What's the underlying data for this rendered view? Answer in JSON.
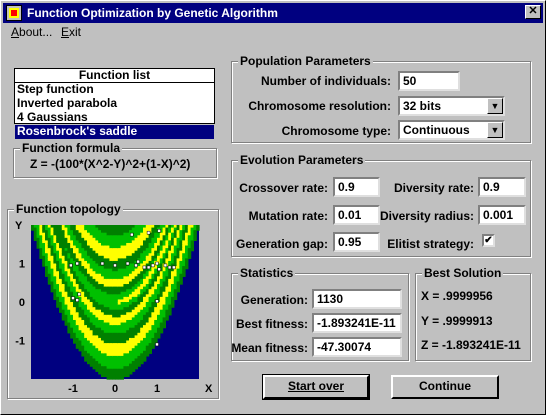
{
  "window": {
    "title": "Function Optimization by Genetic Algorithm",
    "close_glyph": "✕"
  },
  "menu": [
    {
      "mnemonic": "A",
      "rest": "bout..."
    },
    {
      "mnemonic": "E",
      "rest": "xit"
    }
  ],
  "function_list": {
    "header": "Function list",
    "items": [
      "Step function",
      "Inverted parabola",
      "4 Gaussians",
      "Rosenbrock's saddle"
    ],
    "selected": "Rosenbrock's saddle"
  },
  "formula": {
    "legend": "Function formula",
    "text": "Z = -(100*(X^2-Y)^2+(1-X)^2)"
  },
  "topology": {
    "legend": "Function topology",
    "y_axis_label": "Y",
    "x_axis_label": "X",
    "x_ticks": [
      "-1",
      "0",
      "1"
    ],
    "y_ticks": [
      "1",
      "0",
      "-1"
    ],
    "colors": {
      "background": "#000080",
      "light": "#ffff00",
      "mid": "#00c000",
      "dark": "#008000"
    },
    "points": [
      {
        "x": -0.9,
        "y": 1.0
      },
      {
        "x": -1.05,
        "y": 0.95
      },
      {
        "x": -1.0,
        "y": 0.1
      },
      {
        "x": -0.85,
        "y": 0.2
      },
      {
        "x": -0.3,
        "y": 1.0
      },
      {
        "x": 0.0,
        "y": 0.95
      },
      {
        "x": 0.3,
        "y": 1.0
      },
      {
        "x": 0.5,
        "y": 0.95
      },
      {
        "x": 0.55,
        "y": 1.05
      },
      {
        "x": 0.7,
        "y": 0.9
      },
      {
        "x": 0.8,
        "y": 0.9
      },
      {
        "x": 0.9,
        "y": 0.95
      },
      {
        "x": 1.0,
        "y": 1.0
      },
      {
        "x": 1.05,
        "y": 0.85
      },
      {
        "x": 1.2,
        "y": 0.95
      },
      {
        "x": 1.3,
        "y": 0.9
      },
      {
        "x": 1.4,
        "y": 0.9
      },
      {
        "x": 0.4,
        "y": 1.75
      },
      {
        "x": 0.8,
        "y": 1.8
      },
      {
        "x": 1.05,
        "y": 1.85
      },
      {
        "x": 1.0,
        "y": 0.02
      },
      {
        "x": 1.0,
        "y": -1.1
      },
      {
        "x": -0.9,
        "y": 0.05
      }
    ]
  },
  "population": {
    "legend": "Population Parameters",
    "individuals_label": "Number of individuals:",
    "individuals_value": "50",
    "resolution_label": "Chromosome resolution:",
    "resolution_value": "32 bits",
    "type_label": "Chromosome type:",
    "type_value": "Continuous"
  },
  "evolution": {
    "legend": "Evolution Parameters",
    "crossover_label": "Crossover rate:",
    "crossover_value": "0.9",
    "mutation_label": "Mutation rate:",
    "mutation_value": "0.01",
    "gap_label": "Generation gap:",
    "gap_value": "0.95",
    "diversity_label": "Diversity rate:",
    "diversity_value": "0.9",
    "radius_label": "Diversity radius:",
    "radius_value": "0.001",
    "elitist_label": "Elitist strategy:",
    "elitist_checked": true
  },
  "statistics": {
    "legend": "Statistics",
    "generation_label": "Generation:",
    "generation_value": "1130",
    "best_label": "Best fitness:",
    "best_value": "-1.893241E-11",
    "mean_label": "Mean fitness:",
    "mean_value": "-47.30074"
  },
  "best_solution": {
    "legend": "Best Solution",
    "x": "X = .9999956",
    "y": "Y = .9999913",
    "z": "Z = -1.893241E-11"
  },
  "buttons": {
    "start_over": "Start over",
    "continue": "Continue"
  }
}
